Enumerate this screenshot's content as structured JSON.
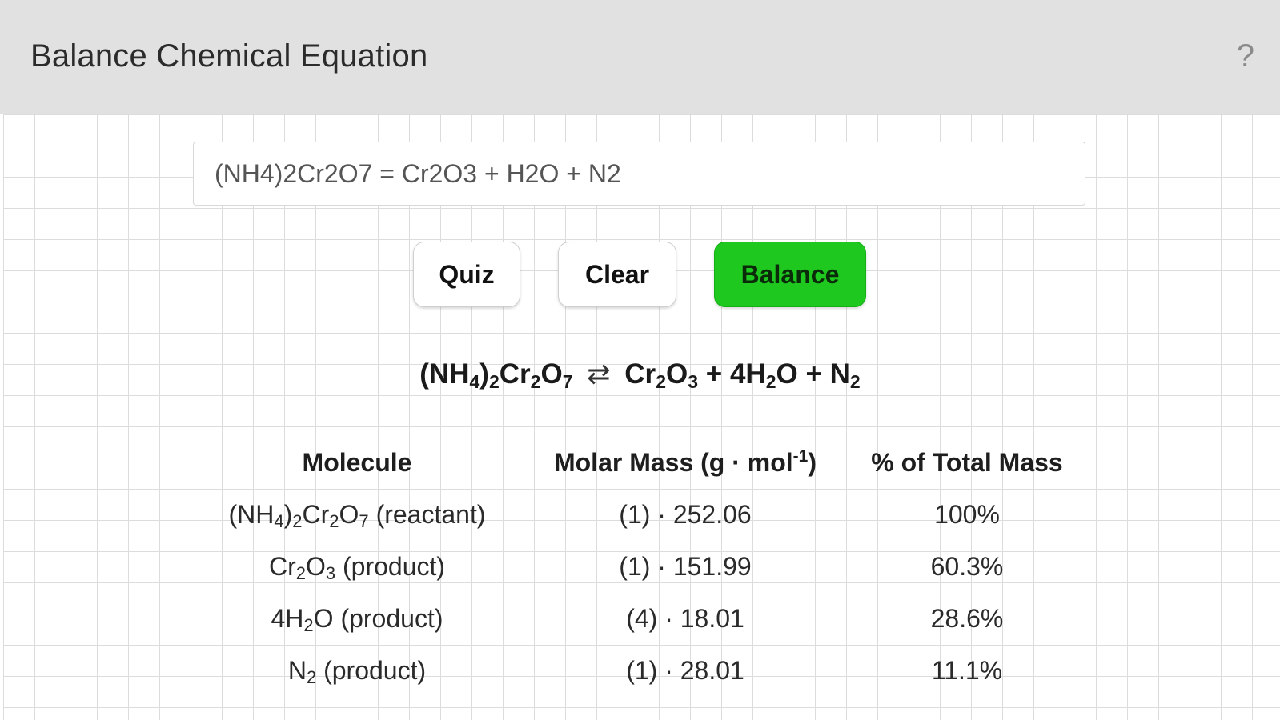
{
  "header": {
    "title": "Balance Chemical Equation",
    "help_icon": "?"
  },
  "input": {
    "value": "(NH4)2Cr2O7 = Cr2O3 + H2O + N2"
  },
  "buttons": {
    "quiz": "Quiz",
    "clear": "Clear",
    "balance": "Balance",
    "balance_color": "#1ec81e"
  },
  "result": {
    "reactant": {
      "p1": "(NH",
      "s1": "4",
      "p2": ")",
      "s2": "2",
      "p3": "Cr",
      "s3": "2",
      "p4": "O",
      "s4": "7"
    },
    "arrow": "⇄",
    "product1": {
      "p1": "Cr",
      "s1": "2",
      "p2": "O",
      "s2": "3"
    },
    "plus": "+",
    "product2": {
      "coef": "4H",
      "s1": "2",
      "p2": "O"
    },
    "product3": {
      "p1": "N",
      "s1": "2"
    }
  },
  "table": {
    "headers": {
      "molecule": "Molecule",
      "molar_mass_prefix": "Molar Mass (g",
      "molar_mass_dot": "·",
      "molar_mass_unit": "mol",
      "molar_mass_exp": "-1",
      "molar_mass_suffix": ")",
      "percent": "% of Total Mass"
    },
    "rows": [
      {
        "mol": {
          "p1": "(NH",
          "s1": "4",
          "p2": ")",
          "s2": "2",
          "p3": "Cr",
          "s3": "2",
          "p4": "O",
          "s4": "7",
          "role": " (reactant)"
        },
        "mass": "(1) · 252.06",
        "percent": "100%"
      },
      {
        "mol": {
          "p1": "Cr",
          "s1": "2",
          "p2": "O",
          "s2": "3",
          "role": " (product)"
        },
        "mass": "(1) · 151.99",
        "percent": "60.3%"
      },
      {
        "mol": {
          "p1": "4H",
          "s1": "2",
          "p2": "O",
          "role": " (product)"
        },
        "mass": "(4) · 18.01",
        "percent": "28.6%"
      },
      {
        "mol": {
          "p1": "N",
          "s1": "2",
          "role": " (product)"
        },
        "mass": "(1) · 28.01",
        "percent": "11.1%"
      }
    ]
  }
}
